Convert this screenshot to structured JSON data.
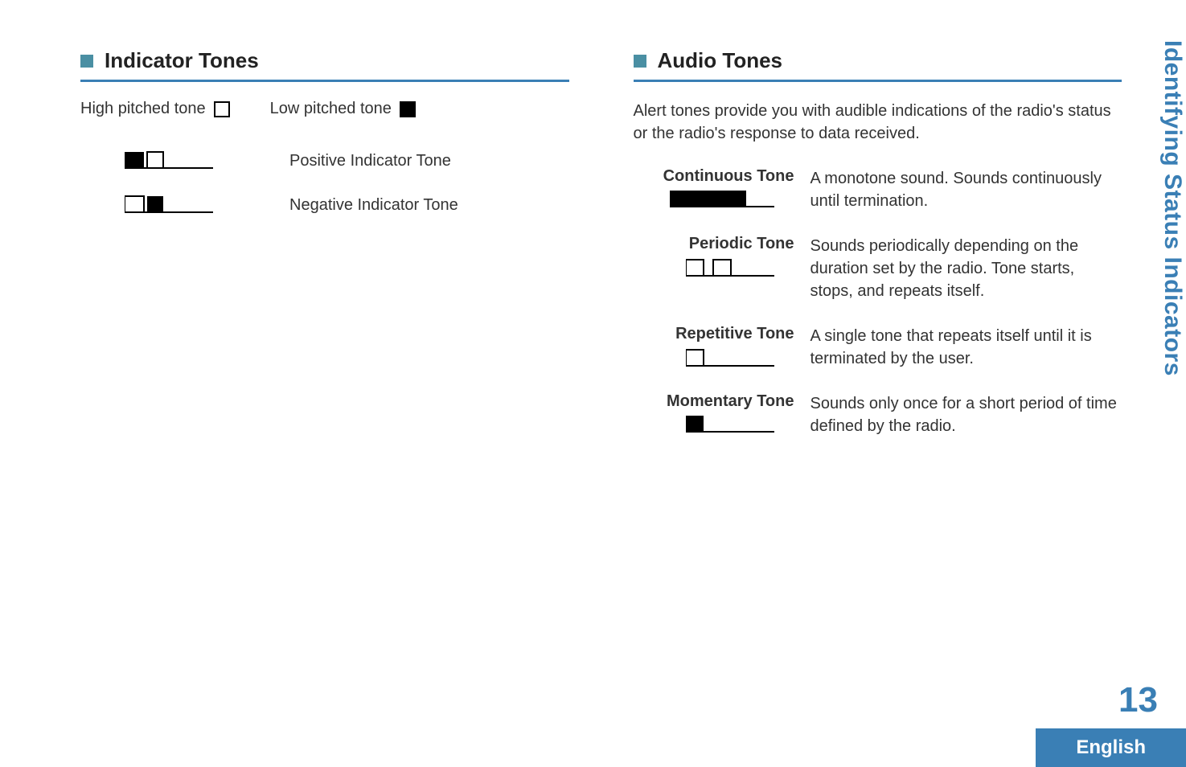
{
  "sideTab": "Identifying Status Indicators",
  "pageNumber": "13",
  "language": "English",
  "left": {
    "heading": "Indicator Tones",
    "highPitched": "High pitched tone",
    "lowPitched": "Low pitched tone",
    "rows": [
      {
        "label": "Positive Indicator Tone"
      },
      {
        "label": "Negative Indicator Tone"
      }
    ]
  },
  "right": {
    "heading": "Audio Tones",
    "intro": "Alert tones provide you with audible indications of the radio's status or the radio's response to data received.",
    "rows": [
      {
        "name": "Continuous Tone",
        "desc": "A monotone sound. Sounds continuously until termination."
      },
      {
        "name": "Periodic Tone",
        "desc": "Sounds periodically depending on the duration set by the radio. Tone starts, stops, and repeats itself."
      },
      {
        "name": "Repetitive Tone",
        "desc": "A single tone that repeats itself until it is terminated by the user."
      },
      {
        "name": "Momentary Tone",
        "desc": "Sounds only once for a short period of time defined by the radio."
      }
    ]
  }
}
